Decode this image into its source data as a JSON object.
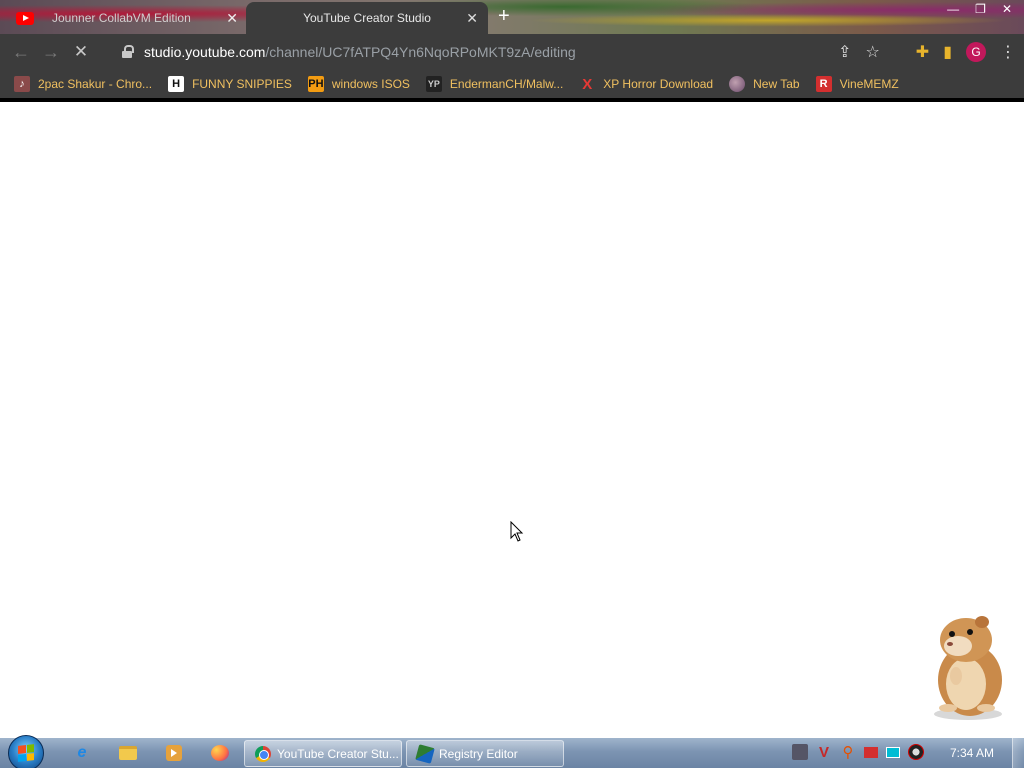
{
  "browser": {
    "tabs": [
      {
        "title": "Jounner CollabVM Edition",
        "active": false
      },
      {
        "title": "YouTube Creator Studio",
        "active": true
      }
    ],
    "new_tab_label": "+",
    "url_host": "studio.youtube.com",
    "url_path": "/channel/UC7fATPQ4Yn6NqoRPoMKT9zA/editing",
    "profile_initial": "G",
    "bookmarks": [
      {
        "label": "2pac Shakur - Chro...",
        "icon": "music-icon"
      },
      {
        "label": "FUNNY SNIPPIES",
        "icon": "h-icon"
      },
      {
        "label": "windows ISOS",
        "icon": "ph-icon"
      },
      {
        "label": "EndermanCH/Malw...",
        "icon": "yp-icon"
      },
      {
        "label": "XP Horror Download",
        "icon": "x-icon"
      },
      {
        "label": "New Tab",
        "icon": "globe-icon"
      },
      {
        "label": "VineMEMZ",
        "icon": "r-icon"
      }
    ]
  },
  "taskbar": {
    "windows": [
      {
        "label": "YouTube Creator Stu...",
        "icon": "chrome-icon"
      },
      {
        "label": "Registry Editor",
        "icon": "registry-icon"
      }
    ],
    "clock": "7:34 AM"
  }
}
